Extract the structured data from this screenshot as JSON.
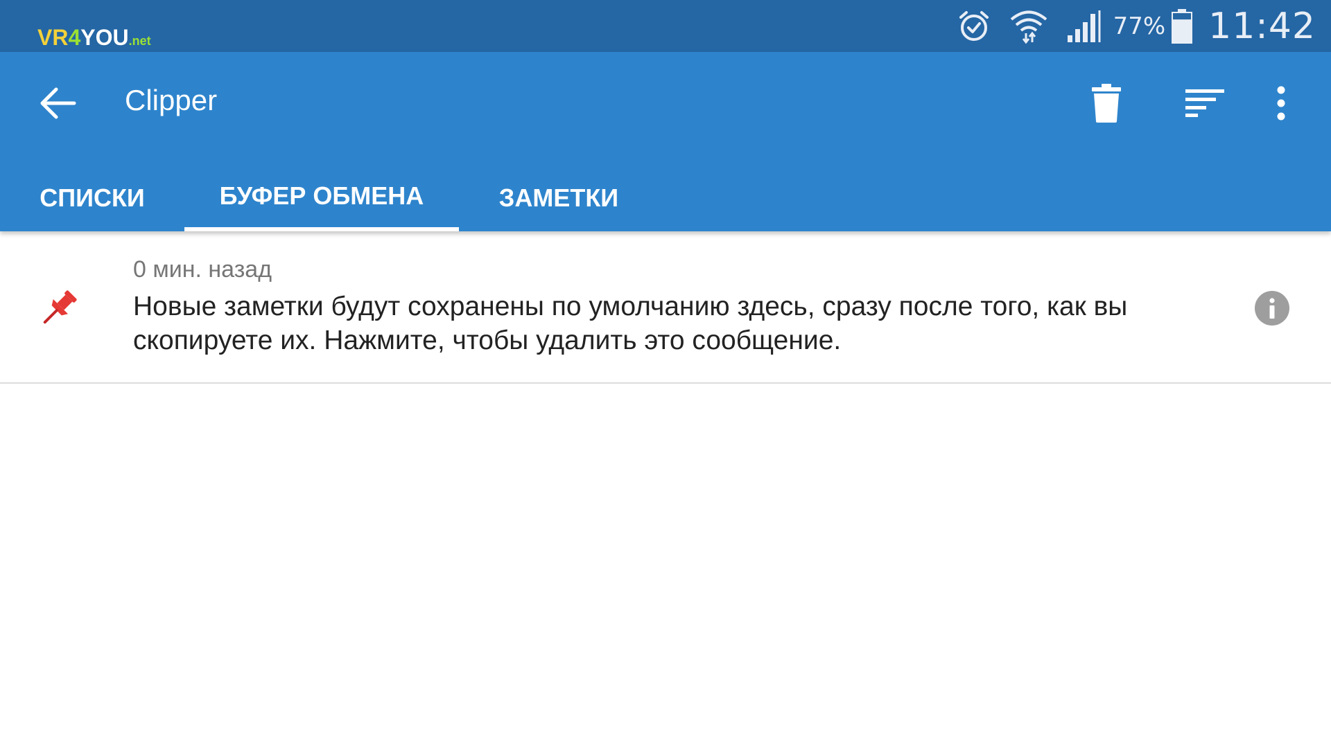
{
  "status_bar": {
    "watermark": {
      "part1": "VR",
      "part2": "4",
      "part3": "YOU",
      "part4": ".net"
    },
    "icons": [
      "alarm-icon",
      "wifi-icon",
      "signal-icon",
      "battery-icon"
    ],
    "battery_percent": "77%",
    "battery_level": 0.77,
    "time": "11:42"
  },
  "app_bar": {
    "title": "Clipper",
    "actions": [
      "delete-icon",
      "sort-icon",
      "more-vertical-icon"
    ],
    "colors": {
      "status_bar": "#2566a4",
      "toolbar": "#2e84cc",
      "accent_pin": "#e53935"
    }
  },
  "tabs": [
    {
      "label": "СПИСКИ",
      "active": false
    },
    {
      "label": "БУФЕР ОБМЕНА",
      "active": true
    },
    {
      "label": "ЗАМЕТКИ",
      "active": false
    }
  ],
  "clips": [
    {
      "time": "0 мин. назад",
      "text": "Новые заметки будут сохранены по умолчанию здесь, сразу после того, как вы скопируете их. Нажмите, чтобы удалить это сообщение.",
      "pinned": true,
      "icon": "pin-icon",
      "action_icon": "info-icon"
    }
  ]
}
